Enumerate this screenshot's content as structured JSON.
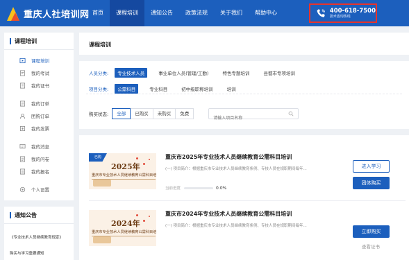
{
  "header": {
    "site_name": "重庆人社培训网",
    "nav": [
      "首页",
      "课程培训",
      "通知公告",
      "政策法规",
      "关于我们",
      "帮助中心"
    ],
    "active_nav": 1,
    "hotline_number": "400-618-7500",
    "hotline_caption": "技术咨询热线"
  },
  "sidebar": {
    "section_title": "课程培训",
    "items": [
      {
        "label": "课程培训",
        "icon": "course-icon"
      },
      {
        "label": "我的考试",
        "icon": "exam-icon"
      },
      {
        "label": "我的证书",
        "icon": "certificate-icon"
      },
      {
        "label": "我的订单",
        "icon": "order-icon"
      },
      {
        "label": "团购订单",
        "icon": "group-order-icon"
      },
      {
        "label": "我的发票",
        "icon": "invoice-icon"
      },
      {
        "label": "我的消息",
        "icon": "message-icon"
      },
      {
        "label": "我的问卷",
        "icon": "survey-icon"
      },
      {
        "label": "我的报名",
        "icon": "registration-icon"
      },
      {
        "label": "个人设置",
        "icon": "settings-icon"
      }
    ],
    "notice_title": "通知公告",
    "notices": [
      "《专业技术人员继续教育规定》",
      "购买与学习重要通知"
    ]
  },
  "main": {
    "page_title": "课程培训",
    "filters": {
      "category_label": "人员分类:",
      "categories": [
        "专业技术人员",
        "事业单位人员(管理/工勤)",
        "特色专题培训",
        "县都市专项培训"
      ],
      "category_selected": 0,
      "type_label": "项目分类:",
      "types": [
        "公需科目",
        "专业科目",
        "初中级职称培训",
        "培训"
      ],
      "type_selected": 0
    },
    "status": {
      "label": "购买状态:",
      "options": [
        "全部",
        "已购买",
        "未购买",
        "免费"
      ],
      "selected": 0,
      "search_placeholder": "请输入项目名称"
    },
    "courses": [
      {
        "title": "重庆市2025年专业技术人员继续教育公需科目培训",
        "desc": "(一) 项目简介：根据重庆市专业技术人员继续教育条例、专技人员在规职期间每年...",
        "thumb_badge": "已购",
        "thumb_year": "2025年",
        "thumb_subtitle": "重庆市专业技术人员继续教育公需科目培训",
        "progress_label": "当前进度",
        "progress_value": "0.0%",
        "progress_fraction": 0.0,
        "buttons": [
          "进入学习",
          "团体购买"
        ]
      },
      {
        "title": "重庆市2024年专业技术人员继续教育公需科目培训",
        "desc": "(一) 项目简介：根据重庆市专业技术人员继续教育条例、专技人员在规职期间每年...",
        "thumb_year": "2024年",
        "thumb_subtitle": "重庆市专业技术人员继续教育公需科目培训",
        "buttons": [
          "立即购买"
        ],
        "link": "查看证书"
      }
    ]
  }
}
